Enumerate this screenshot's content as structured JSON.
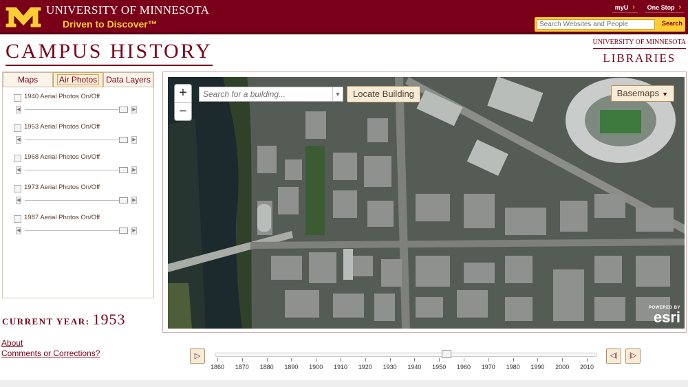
{
  "header": {
    "university": "UNIVERSITY OF MINNESOTA",
    "tagline": "Driven to Discover™",
    "links": [
      {
        "label": "myU",
        "icon": "chevron-right-icon"
      },
      {
        "label": "One Stop",
        "icon": "chevron-right-icon"
      }
    ],
    "search_placeholder": "Search Websites and People",
    "search_button": "Search",
    "logo_icon": "block-m-logo",
    "colors": {
      "maroon": "#7a0019",
      "gold": "#ffcc33"
    }
  },
  "title": "CAMPUS HISTORY",
  "libraries": {
    "line1": "UNIVERSITY OF MINNESOTA",
    "line2": "LIBRARIES"
  },
  "tabs": [
    {
      "label": "Maps",
      "active": false
    },
    {
      "label": "Air Photos",
      "active": true
    },
    {
      "label": "Data Layers",
      "active": false
    }
  ],
  "layers": [
    {
      "label": "1940 Aerial Photos On/Off",
      "checked": false,
      "opacity": 1.0
    },
    {
      "label": "1953 Aerial Photos On/Off",
      "checked": false,
      "opacity": 1.0
    },
    {
      "label": "1968 Aerial Photos On/Off",
      "checked": false,
      "opacity": 1.0
    },
    {
      "label": "1973 Aerial Photos On/Off",
      "checked": false,
      "opacity": 1.0
    },
    {
      "label": "1987 Aerial Photos On/Off",
      "checked": false,
      "opacity": 1.0
    }
  ],
  "current_year": {
    "label": "CURRENT YEAR:",
    "value": "1953"
  },
  "links": {
    "about": "About",
    "comments": "Comments or Corrections?"
  },
  "map": {
    "search_placeholder": "Search for a building...",
    "locate_button": "Locate Building",
    "basemaps_button": "Basemaps",
    "zoom_in": "+",
    "zoom_out": "−",
    "attribution_small": "POWERED BY",
    "attribution_brand": "esri"
  },
  "timeline": {
    "ticks": [
      "1860",
      "1870",
      "1880",
      "1890",
      "1900",
      "1910",
      "1920",
      "1930",
      "1940",
      "1950",
      "1960",
      "1970",
      "1980",
      "1990",
      "2000",
      "2010"
    ],
    "selected_year": 1953
  }
}
